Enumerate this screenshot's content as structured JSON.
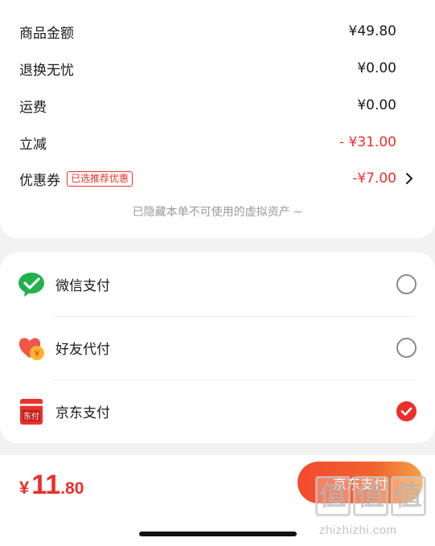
{
  "summary": {
    "rows": [
      {
        "label": "商品金额",
        "value": "¥49.80"
      },
      {
        "label": "退换无忧",
        "value": "¥0.00"
      },
      {
        "label": "运费",
        "value": "¥0.00"
      },
      {
        "label": "立减",
        "value": "- ¥31.00"
      },
      {
        "label": "优惠券",
        "tag": "已选推荐优惠",
        "value": "-¥7.00"
      }
    ],
    "hidden_note": "已隐藏本单不可使用的虚拟资产",
    "hidden_note_icon": "~"
  },
  "payment": {
    "methods": [
      {
        "label": "微信支付",
        "icon": "wechat-pay-icon",
        "selected": false
      },
      {
        "label": "好友代付",
        "icon": "friend-pay-icon",
        "selected": false
      },
      {
        "label": "京东支付",
        "icon": "jd-pay-icon",
        "icon_text": "东付",
        "selected": true
      }
    ]
  },
  "bottom": {
    "currency": "¥",
    "total_integer": "11",
    "total_decimal": ".80",
    "pay_button": "京东支付"
  },
  "watermark": {
    "logo_chars": [
      "值",
      "值",
      "值"
    ],
    "url": "zhizhizhi.com"
  },
  "colors": {
    "accent_red": "#e8312c",
    "wechat_green": "#22b14c",
    "button_gradient_end": "#f4a244"
  }
}
